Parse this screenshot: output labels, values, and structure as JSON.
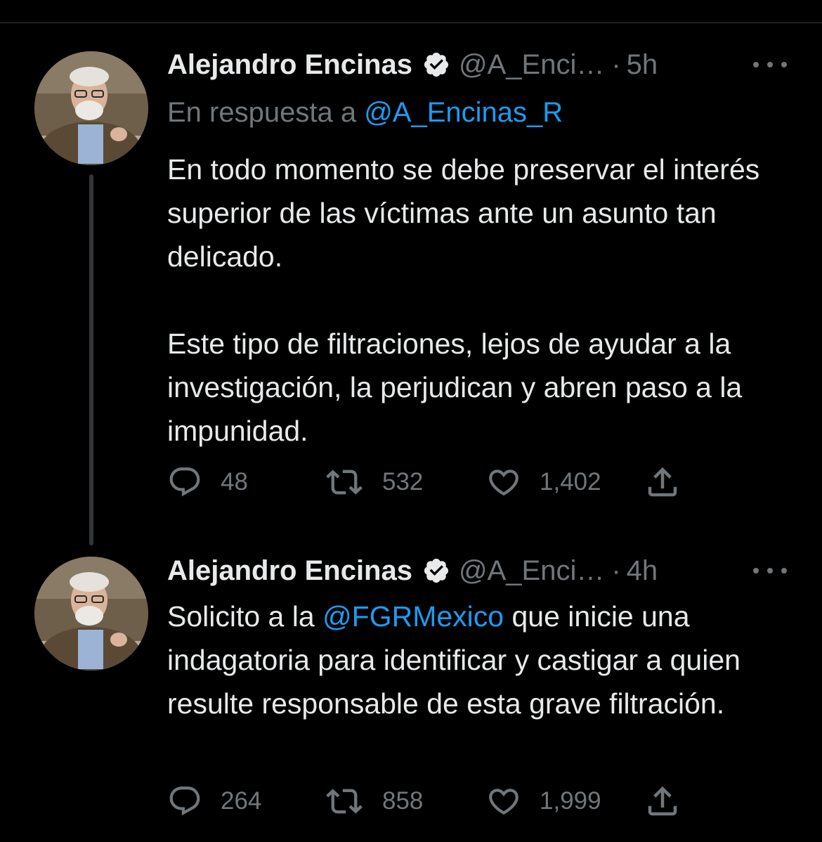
{
  "tweets": [
    {
      "author_name": "Alejandro Encinas",
      "handle": "@A_Enci…",
      "separator": "·",
      "time": "5h",
      "reply_to_prefix": "En respuesta a ",
      "reply_to_handle": "@A_Encinas_R",
      "paragraphs": [
        "En todo momento se debe preservar el interés superior de las víctimas ante un asunto tan delicado.",
        "Este tipo de filtraciones, lejos de ayudar a la investigación, la perjudican y abren paso a la impunidad."
      ],
      "replies": "48",
      "retweets": "532",
      "likes": "1,402"
    },
    {
      "author_name": "Alejandro Encinas",
      "handle": "@A_Enci…",
      "separator": "·",
      "time": "4h",
      "text_before_mention": "Solicito a la ",
      "mention": "@FGRMexico",
      "text_after_mention": " que inicie una indagatoria para identificar y castigar a quien resulte responsable de esta grave filtración.",
      "replies": "264",
      "retweets": "858",
      "likes": "1,999"
    }
  ],
  "icons": {
    "verified": "verified-badge-icon",
    "more": "more-horizontal-icon",
    "reply": "reply-bubble-icon",
    "retweet": "retweet-icon",
    "like": "heart-icon",
    "share": "share-icon"
  },
  "colors": {
    "background": "#000000",
    "text": "#e7e9ea",
    "secondary": "#71767b",
    "link": "#1d9bf0",
    "thread_line": "#333639"
  }
}
